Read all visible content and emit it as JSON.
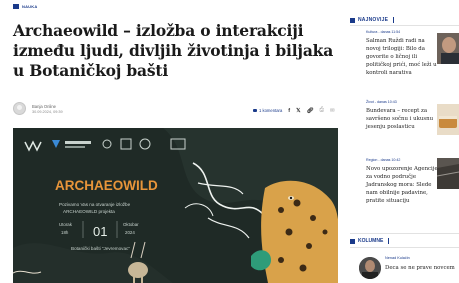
{
  "article": {
    "category_tag": "NAUKA",
    "headline": "Archaeowild – izložba o interakciji između ljudi, divljih životinja i biljaka u Botaničkoj bašti",
    "author_name": "Banja Online",
    "date": "30.09.2024, 09:39",
    "comments_label": "1 komentara",
    "share_icons": [
      "facebook-icon",
      "x-icon",
      "link-icon",
      "print-icon",
      "mail-icon"
    ]
  },
  "hero": {
    "event_title": "ARCHAEOWILD",
    "invite_text": [
      "Pozivamo Vas na otvaranje izložbe",
      "ARCHAEOWILD projekta"
    ],
    "day_label": "Utorak",
    "day_time": "18h",
    "day_number": "01",
    "month_label": "Oktobar",
    "year": "2024",
    "venue": "Botanički bašti \"Jevremovac\"",
    "colors": {
      "bg": "#1f2a26",
      "accent": "#f0a830",
      "title": "#e8953a"
    }
  },
  "sidebar": {
    "news_heading": "NAJNOVIJE",
    "news": [
      {
        "meta": "Kultura - danas 11:54",
        "title": "Salman Ruždi radi na novoj trilogiji: Bilo da govorite o ličnoj ili političkoj prići, moć leži u kontroli narativa"
      },
      {
        "meta": "Život - danas 10:43",
        "title": "Bundevara – recept za savršeno sočnu i ukusnu jesenju poslasticu"
      },
      {
        "meta": "Region - danas 10:42",
        "title": "Novo upozorenje Agencije za vodno područje Jadranskog mora: Slede nam obilnije padavine, pratite situaciju"
      }
    ],
    "columns_heading": "KOLUMNE",
    "column": {
      "author": "Nenad Kulačin",
      "title": "Deca se ne prave novcem"
    }
  }
}
